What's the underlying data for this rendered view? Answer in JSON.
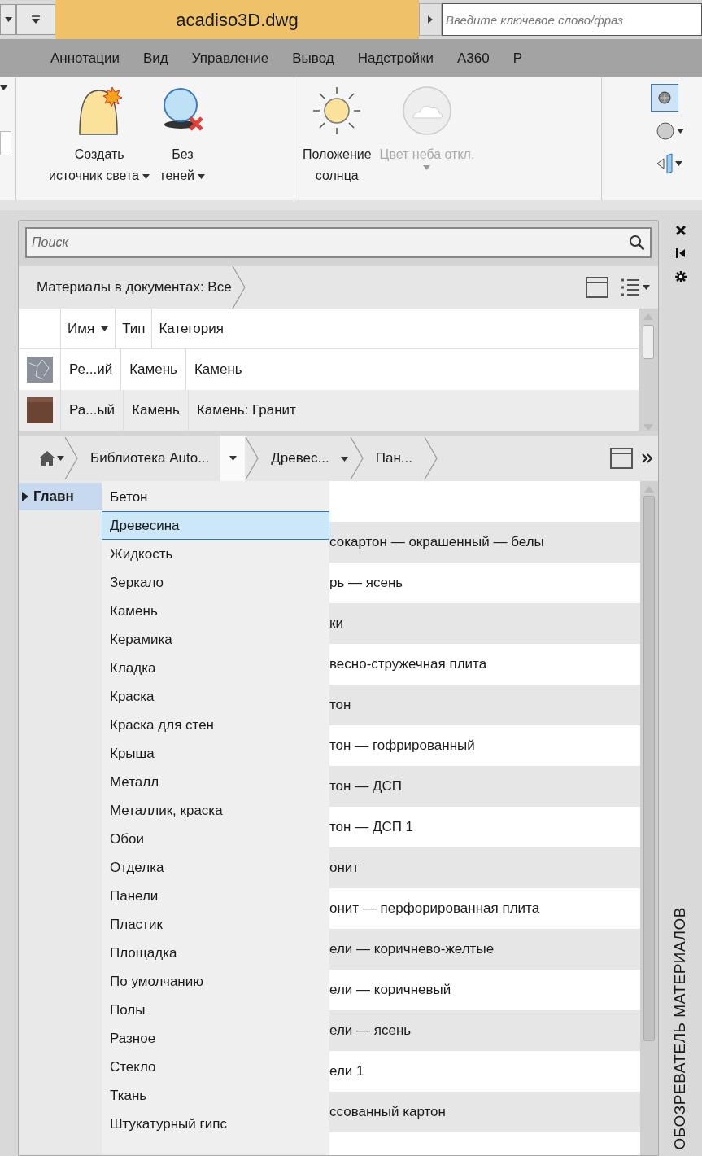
{
  "title_bar": {
    "title": "acadiso3D.dwg",
    "search": {
      "placeholder": "Введите ключевое слово/фраз"
    }
  },
  "menu_tabs": [
    "Аннотации",
    "Вид",
    "Управление",
    "Вывод",
    "Надстройки",
    "A360",
    "Р"
  ],
  "ribbon": {
    "buttons": [
      {
        "kind": "light",
        "label": "Создать\nисточник света",
        "caret": true,
        "caret_below": false,
        "disabled": false
      },
      {
        "kind": "no-shadow",
        "label": "Без\nтеней",
        "caret": true,
        "caret_below": false,
        "disabled": false
      },
      {
        "kind": "sun",
        "label": "Положение\nсолнца",
        "caret": false,
        "disabled": false
      },
      {
        "kind": "sky",
        "label": "Цвет неба откл.",
        "caret": true,
        "caret_below": true,
        "disabled": true
      }
    ]
  },
  "palette": {
    "search": {
      "placeholder": "Поиск"
    },
    "document_materials": {
      "breadcrumb": "Материалы в документах: Все",
      "table": {
        "columns": [
          "Имя",
          "Тип",
          "Категория"
        ],
        "rows": [
          {
            "kind": "stone",
            "cells": [
              "Ре...ий",
              "Камень",
              "Камень"
            ]
          },
          {
            "kind": "granite",
            "cells": [
              "Ра...ый",
              "Камень",
              "Камень: Гранит"
            ]
          }
        ]
      }
    },
    "library": {
      "breadcrumb": [
        "Библиотека Auto...",
        "Древес...",
        "Пан..."
      ],
      "tree": [
        {
          "label": "Главн",
          "selected": true
        }
      ],
      "list": [
        "сокартон — окрашенный — белы",
        "рь — ясень",
        "ки",
        "весно-стружечная плита",
        "тон",
        "тон — гофрированный",
        "тон — ДСП",
        "тон — ДСП 1",
        "онит",
        "онит — перфорированная плита",
        "ели — коричнево-желтые",
        "ели — коричневый",
        "ели — ясень",
        "ели 1",
        "ссованный картон"
      ],
      "dropdown": [
        {
          "label": "Бетон",
          "selected": false
        },
        {
          "label": "Древесина",
          "selected": true
        },
        {
          "label": "Жидкость",
          "selected": false
        },
        {
          "label": "Зеркало",
          "selected": false
        },
        {
          "label": "Камень",
          "selected": false
        },
        {
          "label": "Керамика",
          "selected": false
        },
        {
          "label": "Кладка",
          "selected": false
        },
        {
          "label": "Краска",
          "selected": false
        },
        {
          "label": "Краска для стен",
          "selected": false
        },
        {
          "label": "Крыша",
          "selected": false
        },
        {
          "label": "Металл",
          "selected": false
        },
        {
          "label": "Металлик, краска",
          "selected": false
        },
        {
          "label": "Обои",
          "selected": false
        },
        {
          "label": "Отделка",
          "selected": false
        },
        {
          "label": "Панели",
          "selected": false
        },
        {
          "label": "Пластик",
          "selected": false
        },
        {
          "label": "Площадка",
          "selected": false
        },
        {
          "label": "По умолчанию",
          "selected": false
        },
        {
          "label": "Полы",
          "selected": false
        },
        {
          "label": "Разное",
          "selected": false
        },
        {
          "label": "Стекло",
          "selected": false
        },
        {
          "label": "Ткань",
          "selected": false
        },
        {
          "label": "Штукатурный гипс",
          "selected": false
        }
      ]
    }
  },
  "side_strip": {
    "title": "ОБОЗРЕВАТЕЛЬ МАТЕРИАЛОВ"
  }
}
